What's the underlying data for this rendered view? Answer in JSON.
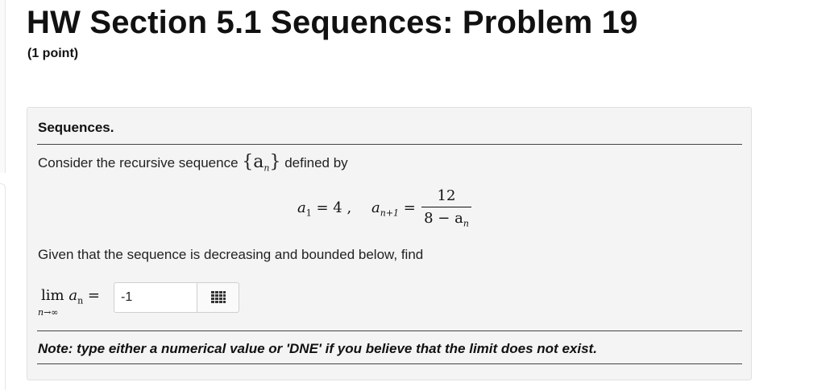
{
  "header": {
    "title": "HW Section 5.1 Sequences: Problem 19",
    "points": "(1 point)"
  },
  "problem": {
    "heading": "Sequences.",
    "intro_text": "Consider the recursive sequence",
    "intro_seq": "{a",
    "intro_seq_sub": "n",
    "intro_seq_close": "}",
    "intro_text_after": "defined by",
    "recursion": {
      "a1_lhs": "a",
      "a1_sub": "1",
      "a1_rhs": "= 4 ,",
      "an1_lhs": "a",
      "an1_sub": "n+1",
      "eq": "=",
      "numerator": "12",
      "denominator": "8 − a",
      "denominator_sub": "n"
    },
    "given_text": "Given that the sequence is decreasing and bounded below, find",
    "limit": {
      "lim": "lim",
      "term": "a",
      "term_sub": "n",
      "eq": "=",
      "under": "n→∞"
    },
    "answer": {
      "value": "-1",
      "placeholder": ""
    },
    "matrix_icon": "grid-icon",
    "note": "Note: type either a numerical value or 'DNE' if you believe that the limit does not exist."
  }
}
